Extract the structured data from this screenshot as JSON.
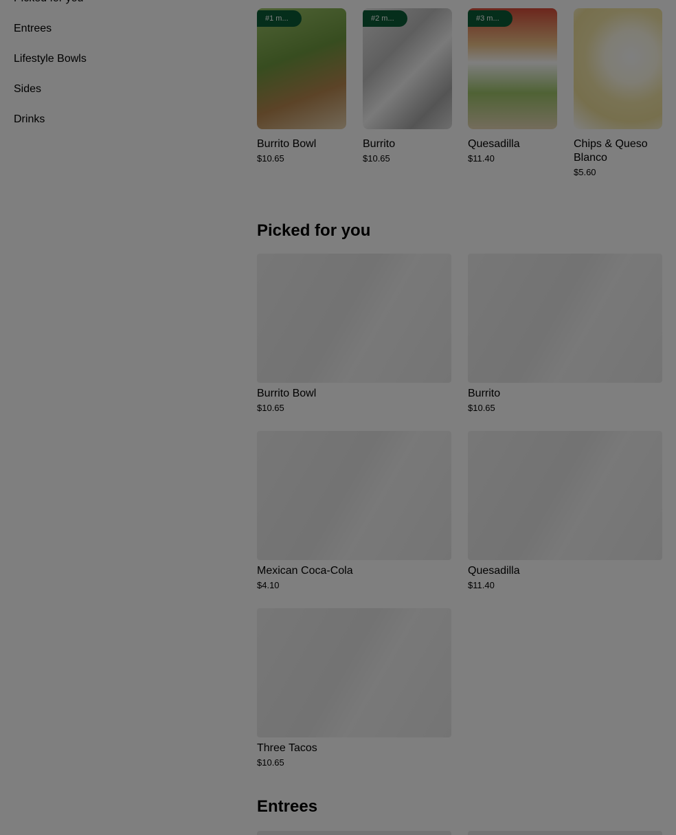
{
  "sidebar": {
    "items": [
      {
        "label": "Picked for you"
      },
      {
        "label": "Entrees"
      },
      {
        "label": "Lifestyle Bowls"
      },
      {
        "label": "Sides"
      },
      {
        "label": "Drinks"
      }
    ]
  },
  "carousel": {
    "items": [
      {
        "badge": "#1 m...",
        "name": "Burrito Bowl",
        "price": "$10.65",
        "image_icon": "burrito-bowl-photo"
      },
      {
        "badge": "#2 m...",
        "name": "Burrito",
        "price": "$10.65",
        "image_icon": "burrito-photo"
      },
      {
        "badge": "#3 m...",
        "name": "Quesadilla",
        "price": "$11.40",
        "image_icon": "quesadilla-photo"
      },
      {
        "badge": "",
        "name": "Chips & Queso Blanco",
        "price": "$5.60",
        "image_icon": "chips-queso-photo"
      }
    ]
  },
  "picked": {
    "title": "Picked for you",
    "items": [
      {
        "name": "Burrito Bowl",
        "price": "$10.65"
      },
      {
        "name": "Burrito",
        "price": "$10.65"
      },
      {
        "name": "Mexican Coca-Cola",
        "price": "$4.10"
      },
      {
        "name": "Quesadilla",
        "price": "$11.40"
      },
      {
        "name": "Three Tacos",
        "price": "$10.65"
      }
    ]
  },
  "entrees": {
    "title": "Entrees"
  },
  "colors": {
    "badge_bg": "#0b5c36",
    "overlay": "rgba(0,0,0,0.5)"
  }
}
